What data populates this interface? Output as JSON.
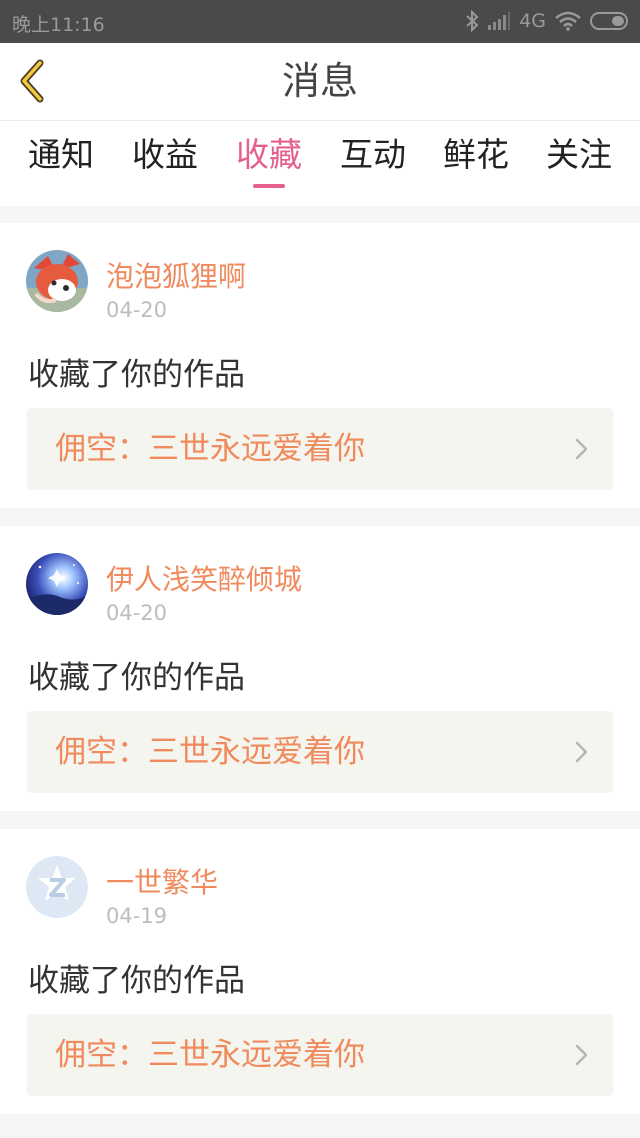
{
  "status_bar": {
    "time": "晚上11:16",
    "network": "4G"
  },
  "header": {
    "title": "消息"
  },
  "tabs": [
    {
      "label": "通知",
      "active": false
    },
    {
      "label": "收益",
      "active": false
    },
    {
      "label": "收藏",
      "active": true
    },
    {
      "label": "互动",
      "active": false
    },
    {
      "label": "鲜花",
      "active": false
    },
    {
      "label": "关注",
      "active": false
    }
  ],
  "colors": {
    "accent": "#e5608c",
    "name": "#f08a5d",
    "status_bar": "#4a4a4a",
    "work_bg": "#f5f5ef"
  },
  "messages": [
    {
      "username": "泡泡狐狸啊",
      "date": "04-20",
      "action": "收藏了你的作品",
      "work_title": "佣空：三世永远爱着你",
      "avatar": "fox-avatar"
    },
    {
      "username": "伊人浅笑醉倾城",
      "date": "04-20",
      "action": "收藏了你的作品",
      "work_title": "佣空：三世永远爱着你",
      "avatar": "night-sky-avatar"
    },
    {
      "username": "一世繁华",
      "date": "04-19",
      "action": "收藏了你的作品",
      "work_title": "佣空：三世永远爱着你",
      "avatar": "default-z-avatar"
    }
  ]
}
